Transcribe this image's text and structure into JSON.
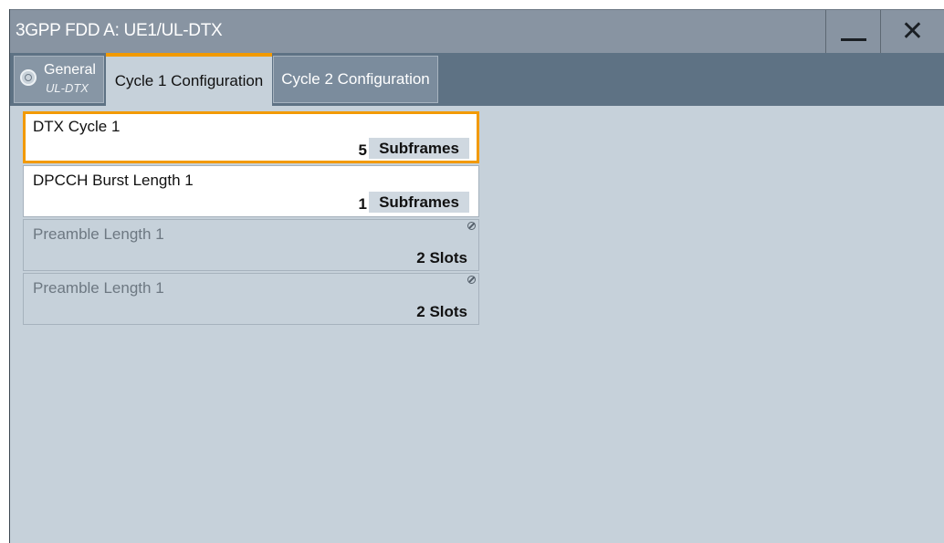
{
  "window": {
    "title": "3GPP FDD A: UE1/UL-DTX",
    "minimize_icon": "minimize-icon",
    "close_icon": "close-icon",
    "close_glyph": "✕"
  },
  "tabs": [
    {
      "title": "General",
      "subtitle": "UL-DTX",
      "icon": "toggle-circle-icon",
      "selected": false
    },
    {
      "label": "Cycle 1 Configuration",
      "selected": true
    },
    {
      "label": "Cycle 2 Configuration",
      "selected": false
    }
  ],
  "fields": [
    {
      "label": "DTX Cycle 1",
      "value": "5",
      "unit": "Subframes",
      "state": "focused"
    },
    {
      "label": "DPCCH Burst Length 1",
      "value": "1",
      "unit": "Subframes",
      "state": "enabled"
    },
    {
      "label": "Preamble Length 1",
      "value": "2",
      "unit": "Slots",
      "state": "disabled",
      "icon": "disabled-icon"
    },
    {
      "label": "Preamble Length 1",
      "value": "2",
      "unit": "Slots",
      "state": "disabled",
      "icon": "disabled-icon"
    }
  ],
  "colors": {
    "accent": "#f29a00",
    "titlebar": "#8894a2",
    "tabstrip": "#5e7284",
    "panel": "#c6d1da"
  }
}
